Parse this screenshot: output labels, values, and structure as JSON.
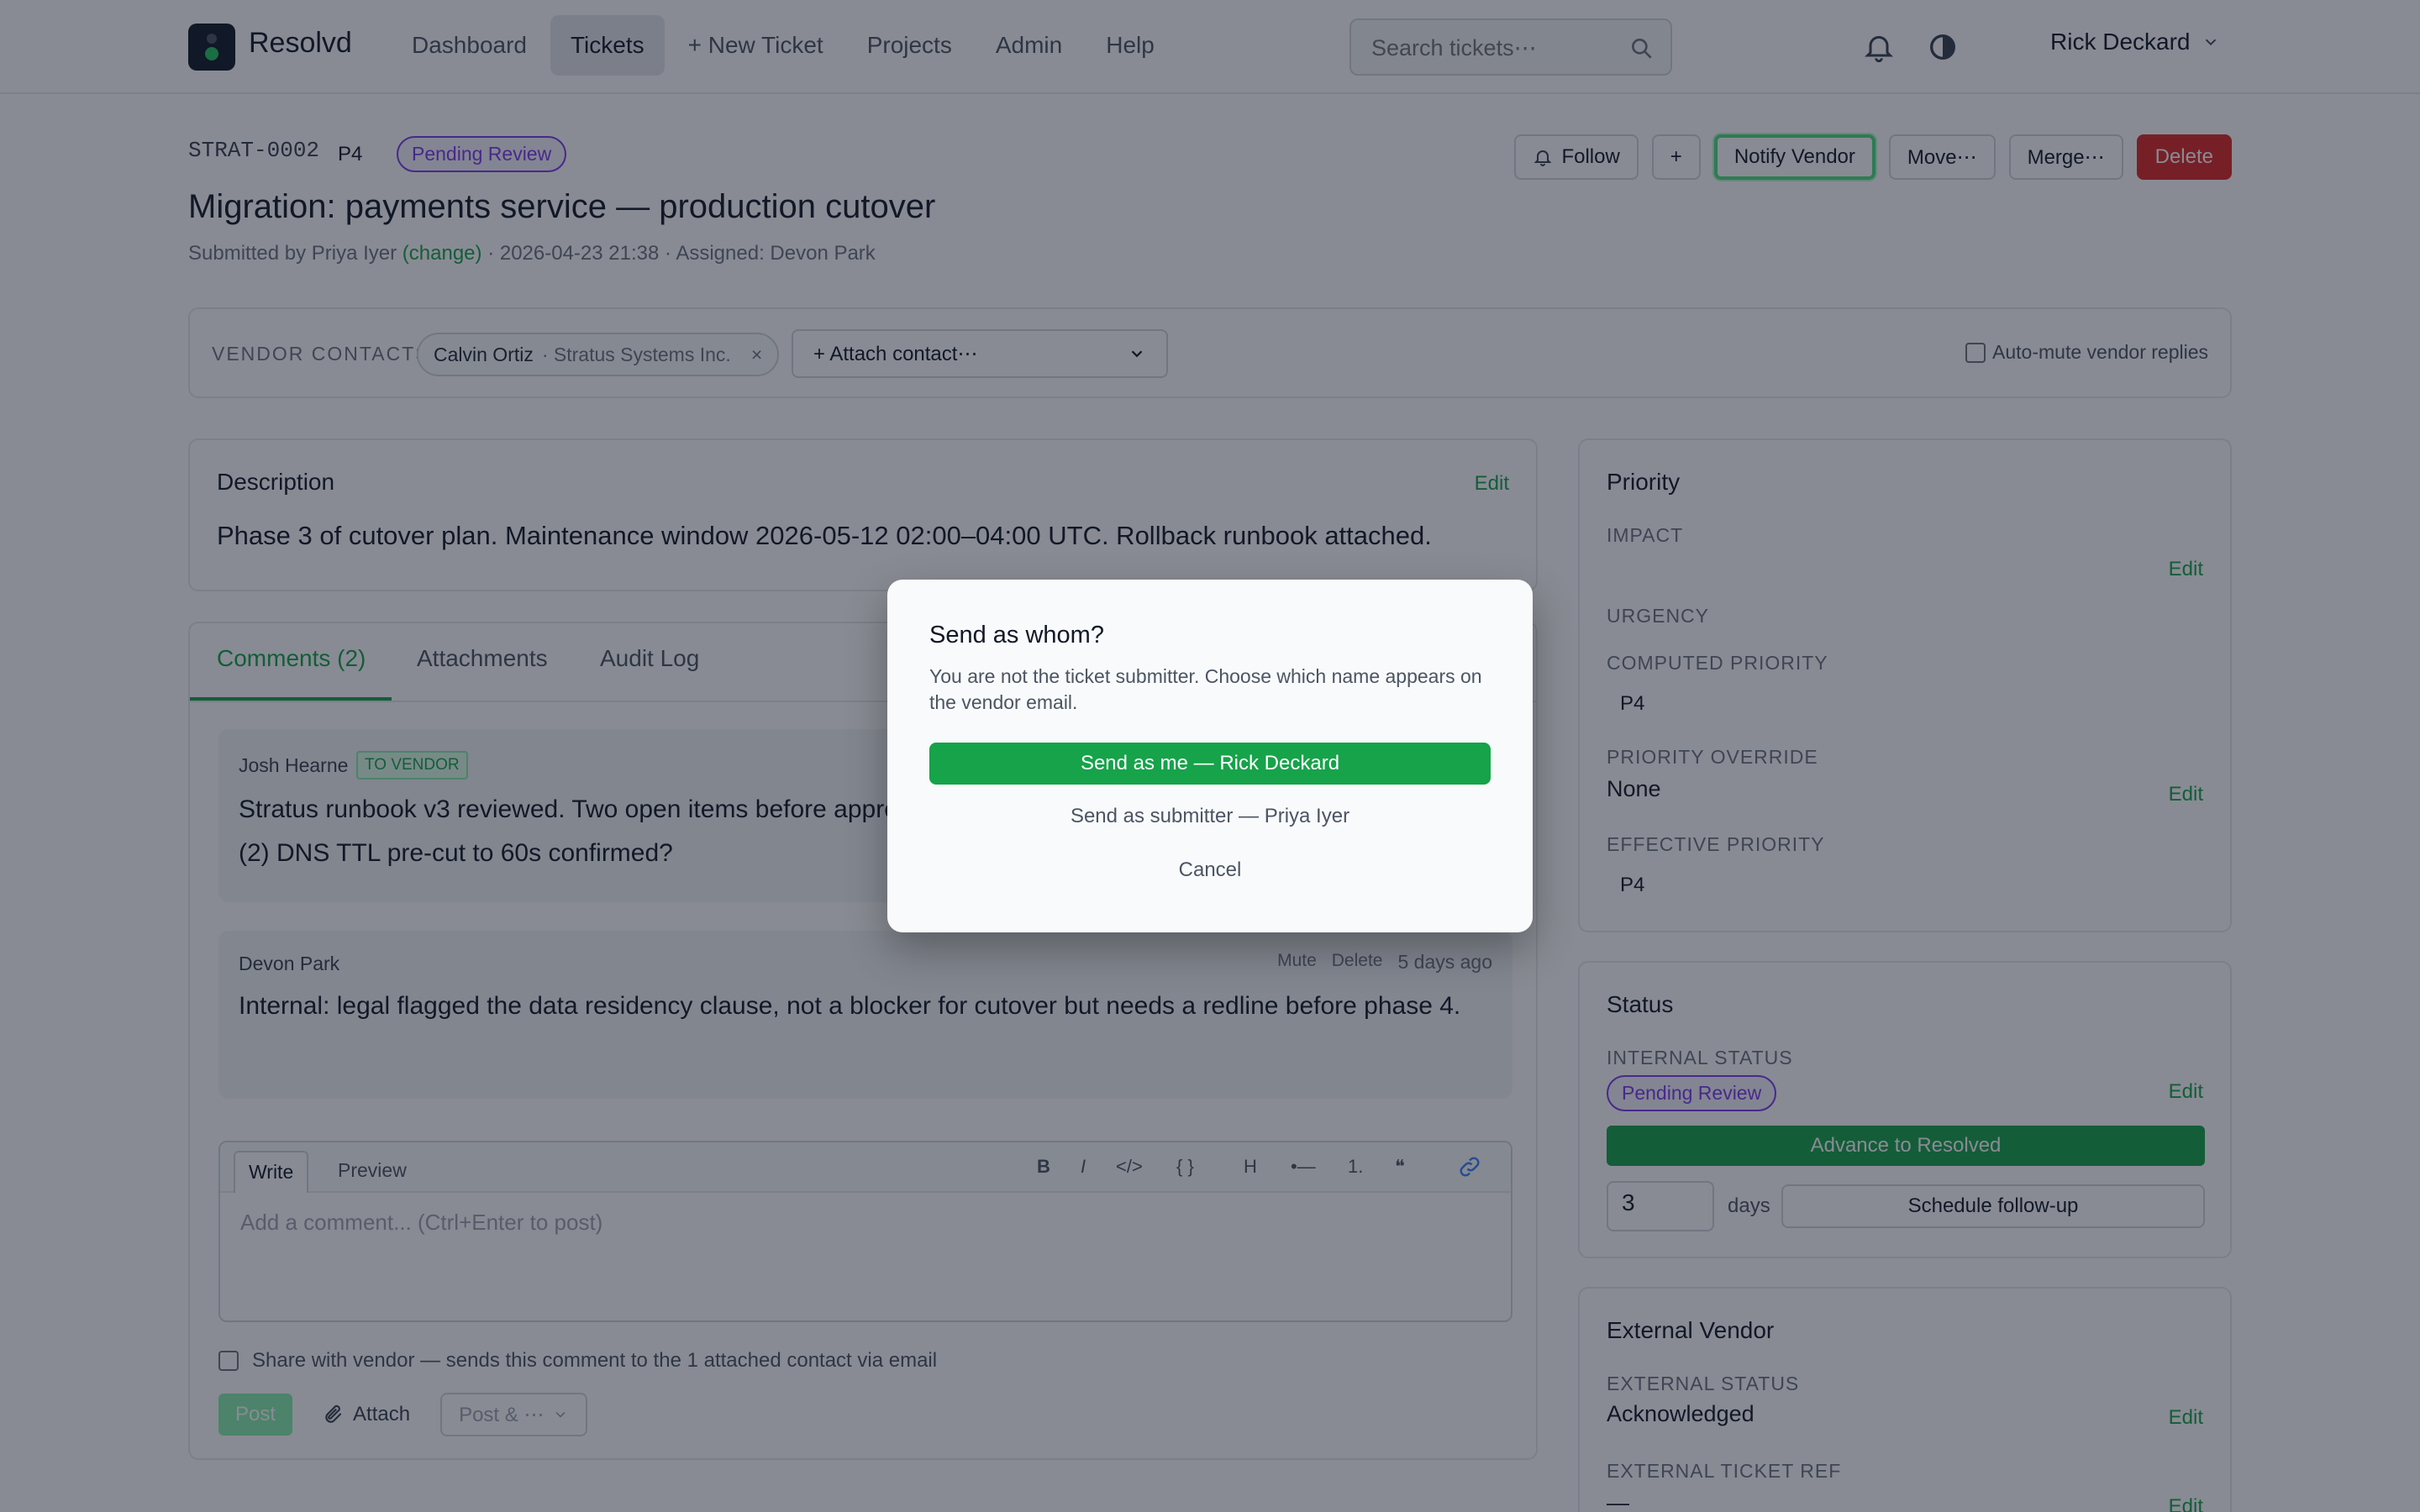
{
  "app": {
    "name": "Resolvd"
  },
  "nav": {
    "items": [
      {
        "label": "Dashboard",
        "active": false
      },
      {
        "label": "Tickets",
        "active": true
      },
      {
        "label": "+ New Ticket",
        "active": false
      },
      {
        "label": "Projects",
        "active": false
      },
      {
        "label": "Admin",
        "active": false
      },
      {
        "label": "Help",
        "active": false
      }
    ]
  },
  "search": {
    "placeholder": "Search tickets⋯"
  },
  "user": {
    "name": "Rick Deckard"
  },
  "ticket": {
    "id": "STRAT-0002",
    "priority": "P4",
    "status": "Pending Review",
    "title": "Migration: payments service — production cutover",
    "submitted_prefix": "Submitted by Priya Iyer",
    "change_link": "(change)",
    "submitted_suffix": "· 2026-04-23 21:38 · Assigned: Devon Park"
  },
  "actions": {
    "follow": "Follow",
    "plus": "+",
    "notify": "Notify Vendor",
    "move": "Move⋯",
    "merge": "Merge⋯",
    "delete": "Delete"
  },
  "vendor_contacts": {
    "label": "VENDOR CONTACTS",
    "contact_name": "Calvin Ortiz",
    "contact_org": "· Stratus Systems Inc.",
    "remove": "×",
    "attach": "+ Attach contact⋯",
    "automute": "Auto-mute vendor replies"
  },
  "description": {
    "heading": "Description",
    "edit": "Edit",
    "body": "Phase 3 of cutover plan. Maintenance window 2026-05-12 02:00–04:00 UTC. Rollback runbook attached."
  },
  "tabs": {
    "comments": "Comments (2)",
    "attachments": "Attachments",
    "audit": "Audit Log"
  },
  "comments": [
    {
      "author": "Josh Hearne",
      "tag": "TO VENDOR",
      "body": "Stratus runbook v3 reviewed. Two open items before approval: (1) connection drain timeout is 30s, want 90s, (2) DNS TTL pre-cut to 60s confirmed?"
    },
    {
      "author": "Devon Park",
      "mute": "Mute",
      "delete": "Delete",
      "time": "5 days ago",
      "body": "Internal: legal flagged the data residency clause, not a blocker for cutover but needs a redline before phase 4."
    }
  ],
  "editor": {
    "write": "Write",
    "preview": "Preview",
    "placeholder": "Add a comment... (Ctrl+Enter to post)",
    "fmt": {
      "bold": "B",
      "italic": "I",
      "code": "</>",
      "block": "{ }",
      "heading": "H",
      "bullet": "•—",
      "numbered": "1.",
      "quote": "❝"
    }
  },
  "share": {
    "label": "Share with vendor — sends this comment to the 1 attached contact via email"
  },
  "post": {
    "post": "Post",
    "attach": "Attach",
    "post_and": "Post & ⋯"
  },
  "priority_card": {
    "heading": "Priority",
    "impact": "IMPACT",
    "impact_edit": "Edit",
    "urgency": "URGENCY",
    "computed": "COMPUTED PRIORITY",
    "computed_val": "P4",
    "override": "PRIORITY OVERRIDE",
    "override_val": "None",
    "override_edit": "Edit",
    "effective": "EFFECTIVE PRIORITY",
    "effective_val": "P4"
  },
  "status_card": {
    "heading": "Status",
    "internal": "INTERNAL STATUS",
    "internal_val": "Pending Review",
    "edit": "Edit",
    "advance": "Advance to Resolved",
    "days_value": "3",
    "days": "days",
    "schedule": "Schedule follow-up"
  },
  "vendor_card": {
    "heading": "External Vendor",
    "ext_status": "EXTERNAL STATUS",
    "ext_status_val": "Acknowledged",
    "edit": "Edit",
    "ext_ref": "EXTERNAL TICKET REF",
    "ext_ref_val": "—",
    "ref_edit": "Edit"
  },
  "modal": {
    "title": "Send as whom?",
    "text": "You are not the ticket submitter. Choose which name appears on the vendor email.",
    "primary": "Send as me — Rick Deckard",
    "secondary": "Send as submitter — Priya Iyer",
    "cancel": "Cancel"
  },
  "colors": {
    "accent": "#16a34a",
    "danger": "#dc2626",
    "status_purple": "#7c3aed"
  }
}
